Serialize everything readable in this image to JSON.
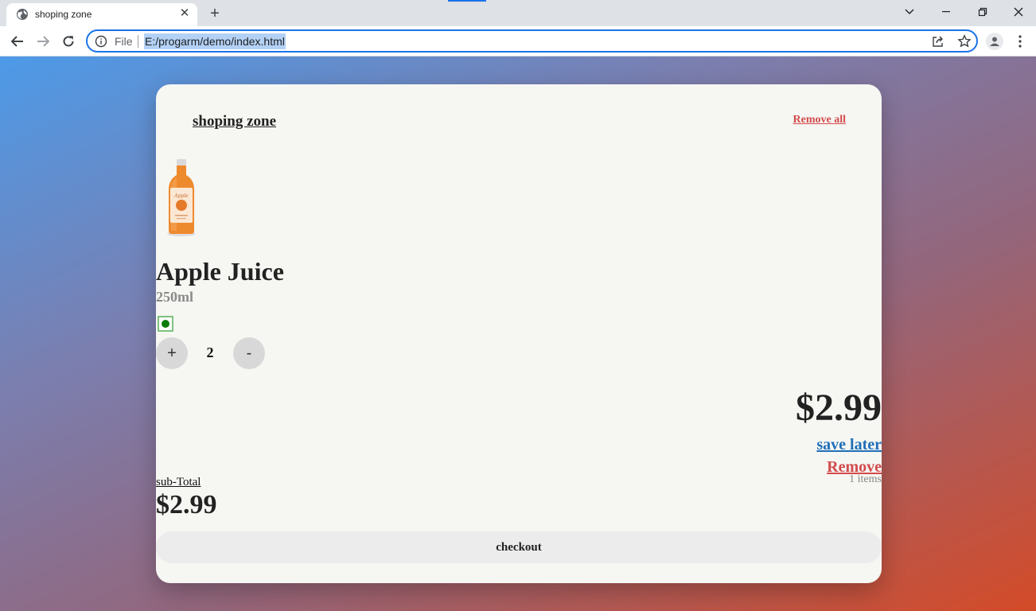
{
  "browser": {
    "tab_title": "shoping zone",
    "url_scheme": "File",
    "url": "E:/progarm/demo/index.html"
  },
  "cart": {
    "heading": "shoping zone",
    "remove_all": "Remove all",
    "product": {
      "name": "Apple Juice",
      "size": "250ml",
      "quantity": "2",
      "price": "$2.99",
      "plus_label": "+",
      "minus_label": "-"
    },
    "save_later": "save later",
    "remove": "Remove",
    "items_count": "1 items",
    "subtotal_label": "sub-Total",
    "subtotal_value": "$2.99",
    "checkout_label": "checkout"
  },
  "colors": {
    "accent": "#1a73e8",
    "remove": "#d24b4b",
    "save_later": "#1f6fb8",
    "in_stock_dot": "#0a7a0a",
    "card": "#f6f6f3"
  }
}
